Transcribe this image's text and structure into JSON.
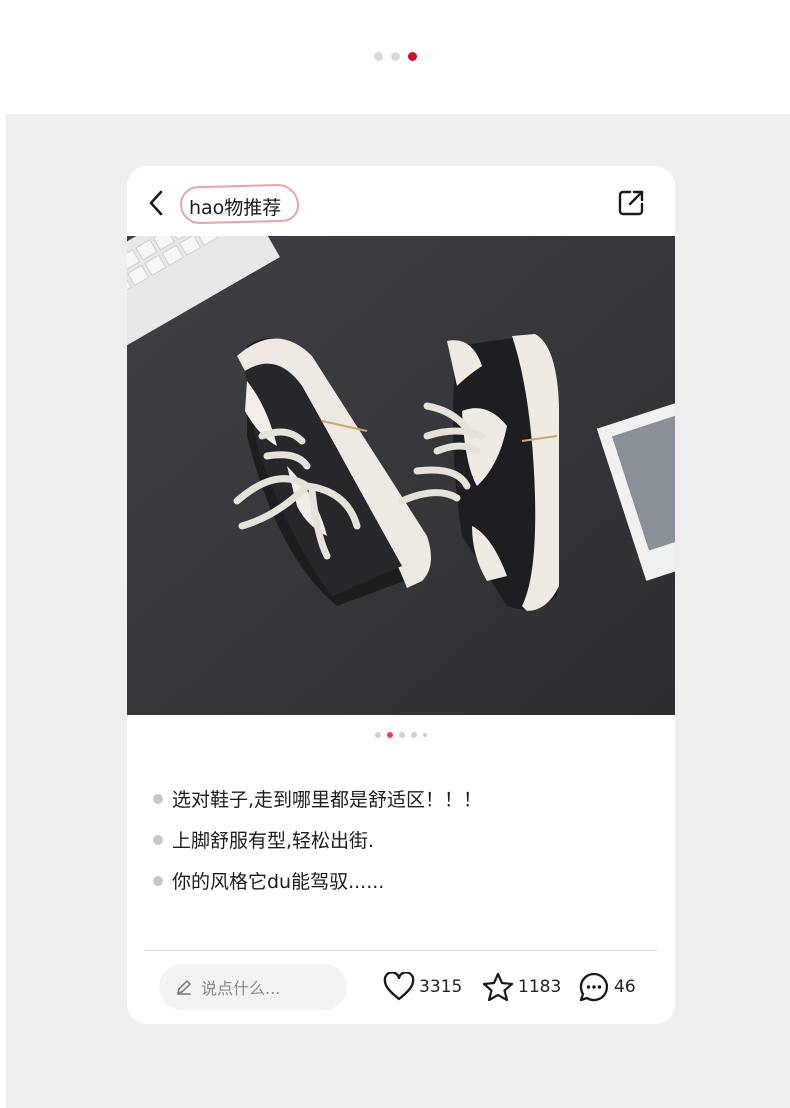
{
  "page_indicator": {
    "count": 3,
    "active_index": 2
  },
  "header": {
    "title": "hao物推荐",
    "back_icon": "chevron-left-icon",
    "share_icon": "share-external-icon"
  },
  "image_indicator": {
    "count": 5,
    "active_index": 1
  },
  "bullets": [
    {
      "text": "选对鞋子,走到哪里都是舒适区！！！"
    },
    {
      "text": "上脚舒服有型,轻松出街."
    },
    {
      "text": "你的风格它du能驾驭......"
    }
  ],
  "footer": {
    "comment_placeholder": "说点什么...",
    "likes": "3315",
    "favorites": "1183",
    "comments": "46"
  },
  "colors": {
    "accent": "#c8102e",
    "title_outline": "#e8a4ad",
    "stage_background": "#efefef"
  }
}
